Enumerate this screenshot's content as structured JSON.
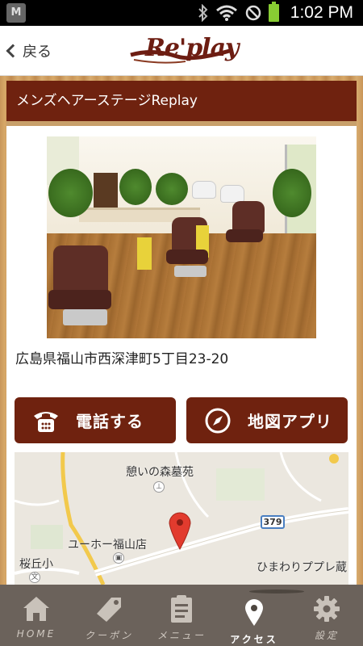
{
  "status_bar": {
    "time": "1:02 PM",
    "app_icon_letter": "M",
    "icons": [
      "bluetooth-icon",
      "wifi-icon",
      "no-signal-icon",
      "battery-icon"
    ]
  },
  "header": {
    "back_label": "戻る",
    "logo_text": "Re'play"
  },
  "page": {
    "title": "メンズヘアーステージReplay",
    "address": "広島県福山市西深津町5丁目23-20"
  },
  "actions": {
    "call_label": "電話する",
    "map_label": "地図アプリ"
  },
  "map": {
    "labels": {
      "place1": "憩いの森墓苑",
      "place2": "ユーホー福山店",
      "place3": "桜丘小",
      "place4": "ひまわりププレ蔵"
    },
    "route_number": "379"
  },
  "tabs": [
    {
      "label": "HOME",
      "icon": "home-icon"
    },
    {
      "label": "クーポン",
      "icon": "coupon-tag-icon"
    },
    {
      "label": "メニュー",
      "icon": "menu-clipboard-icon"
    },
    {
      "label": "アクセス",
      "icon": "location-pin-icon",
      "active": true
    },
    {
      "label": "設定",
      "icon": "gear-icon"
    }
  ],
  "colors": {
    "brand_brown": "#6f220f",
    "tabbar_bg": "#6b625b",
    "wood": "#c9975a"
  }
}
